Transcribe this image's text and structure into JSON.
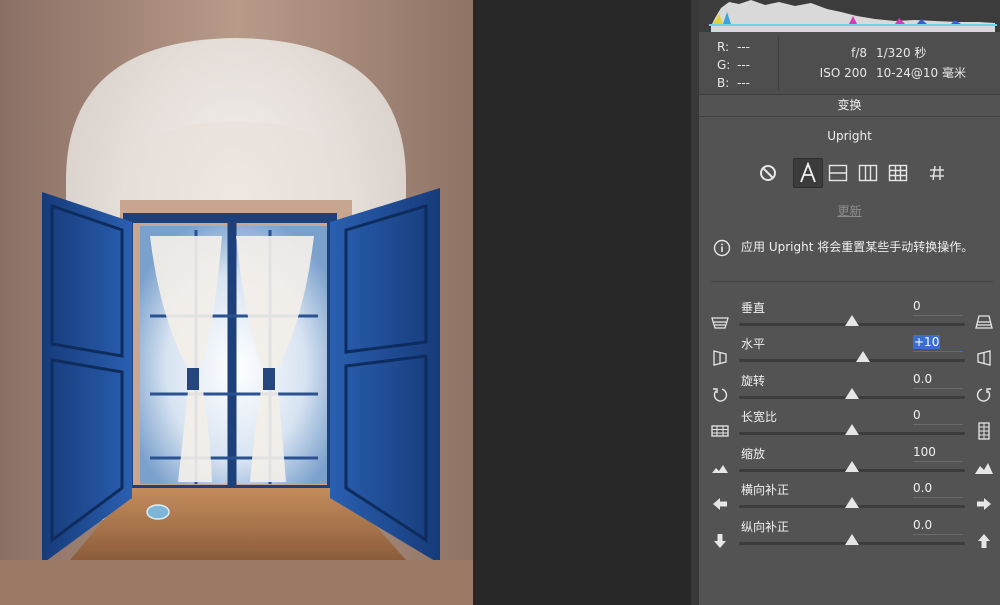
{
  "info": {
    "rgb": [
      {
        "key": "R:",
        "value": "---"
      },
      {
        "key": "G:",
        "value": "---"
      },
      {
        "key": "B:",
        "value": "---"
      }
    ],
    "camera": {
      "aperture": "f/8",
      "shutter": "1/320 秒",
      "iso": "ISO 200",
      "lens": "10-24@10 毫米"
    }
  },
  "section_title": "变换",
  "upright": {
    "label": "Upright",
    "buttons": [
      "off-icon",
      "auto-upright-icon",
      "level-icon",
      "vertical-icon",
      "full-icon",
      "guided-icon"
    ],
    "selected": "auto-upright-icon",
    "update_label": "更新",
    "note": "应用 Upright 将会重置某些手动转换操作。"
  },
  "sliders": [
    {
      "label": "垂直",
      "value": "0",
      "position": 0.5
    },
    {
      "label": "水平",
      "value": "+10",
      "position": 0.55,
      "active": true
    },
    {
      "label": "旋转",
      "value": "0.0",
      "position": 0.5
    },
    {
      "label": "长宽比",
      "value": "0",
      "position": 0.5
    },
    {
      "label": "缩放",
      "value": "100",
      "position": 0.5
    },
    {
      "label": "横向补正",
      "value": "0.0",
      "position": 0.5
    },
    {
      "label": "纵向补正",
      "value": "0.0",
      "position": 0.5
    }
  ],
  "colors": {
    "panel": "#535353",
    "accent": "#3a6fd0",
    "shutter_blue": "#1e4f98"
  }
}
